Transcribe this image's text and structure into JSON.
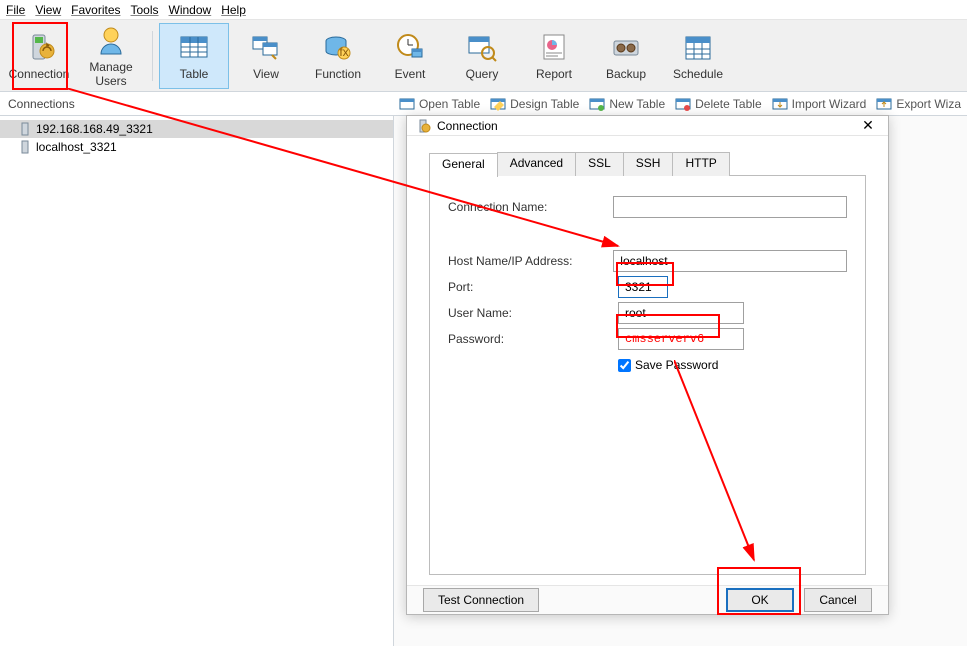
{
  "menu": {
    "items": [
      "File",
      "View",
      "Favorites",
      "Tools",
      "Window",
      "Help"
    ]
  },
  "toolbar": {
    "connection": "Connection",
    "manage_users": "Manage Users",
    "table": "Table",
    "view": "View",
    "function": "Function",
    "event": "Event",
    "query": "Query",
    "report": "Report",
    "backup": "Backup",
    "schedule": "Schedule"
  },
  "subbar": {
    "connections_label": "Connections",
    "open_table": "Open Table",
    "design_table": "Design Table",
    "new_table": "New Table",
    "delete_table": "Delete Table",
    "import_wizard": "Import Wizard",
    "export_wizard": "Export Wiza"
  },
  "tree": {
    "items": [
      "192.168.168.49_3321",
      "localhost_3321"
    ]
  },
  "dialog": {
    "title": "Connection",
    "tabs": {
      "general": "General",
      "advanced": "Advanced",
      "ssl": "SSL",
      "ssh": "SSH",
      "http": "HTTP"
    },
    "labels": {
      "conn_name": "Connection Name:",
      "host": "Host Name/IP Address:",
      "port": "Port:",
      "user": "User Name:",
      "password": "Password:",
      "save_pwd": "Save Password"
    },
    "values": {
      "conn_name": "",
      "host": "localhost",
      "port": "3321",
      "user": "root",
      "password": "cmsserverv6"
    },
    "buttons": {
      "test": "Test Connection",
      "ok": "OK",
      "cancel": "Cancel"
    }
  }
}
